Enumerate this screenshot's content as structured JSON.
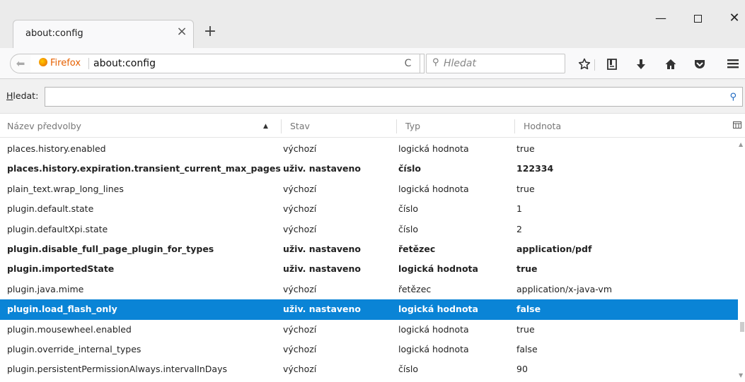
{
  "window": {
    "min_glyph": "—",
    "close_glyph": "✕"
  },
  "tab": {
    "title": "about:config",
    "close_glyph": "×",
    "newtab_glyph": "+"
  },
  "navbar": {
    "back_glyph": "⬅",
    "identity_label": "Firefox",
    "url": "about:config",
    "reload_glyph": "C",
    "search_placeholder": "Hledat",
    "search_glyph": "⚲",
    "icons": [
      "star-icon",
      "reading-list-icon",
      "download-icon",
      "home-icon",
      "pocket-icon",
      "menu-icon"
    ]
  },
  "filter": {
    "label_first": "H",
    "label_rest": "ledat:",
    "value": "",
    "search_glyph": "⚲"
  },
  "columns": {
    "name": "Název předvolby",
    "status": "Stav",
    "type": "Typ",
    "value": "Hodnota"
  },
  "rows": [
    {
      "name": "places.history.enabled",
      "status": "výchozí",
      "type": "logická hodnota",
      "value": "true",
      "modified": false,
      "selected": false
    },
    {
      "name": "places.history.expiration.transient_current_max_pages",
      "status": "uživ. nastaveno",
      "type": "číslo",
      "value": "122334",
      "modified": true,
      "selected": false
    },
    {
      "name": "plain_text.wrap_long_lines",
      "status": "výchozí",
      "type": "logická hodnota",
      "value": "true",
      "modified": false,
      "selected": false
    },
    {
      "name": "plugin.default.state",
      "status": "výchozí",
      "type": "číslo",
      "value": "1",
      "modified": false,
      "selected": false
    },
    {
      "name": "plugin.defaultXpi.state",
      "status": "výchozí",
      "type": "číslo",
      "value": "2",
      "modified": false,
      "selected": false
    },
    {
      "name": "plugin.disable_full_page_plugin_for_types",
      "status": "uživ. nastaveno",
      "type": "řetězec",
      "value": "application/pdf",
      "modified": true,
      "selected": false
    },
    {
      "name": "plugin.importedState",
      "status": "uživ. nastaveno",
      "type": "logická hodnota",
      "value": "true",
      "modified": true,
      "selected": false
    },
    {
      "name": "plugin.java.mime",
      "status": "výchozí",
      "type": "řetězec",
      "value": "application/x-java-vm",
      "modified": false,
      "selected": false
    },
    {
      "name": "plugin.load_flash_only",
      "status": "uživ. nastaveno",
      "type": "logická hodnota",
      "value": "false",
      "modified": true,
      "selected": true
    },
    {
      "name": "plugin.mousewheel.enabled",
      "status": "výchozí",
      "type": "logická hodnota",
      "value": "true",
      "modified": false,
      "selected": false
    },
    {
      "name": "plugin.override_internal_types",
      "status": "výchozí",
      "type": "logická hodnota",
      "value": "false",
      "modified": false,
      "selected": false
    },
    {
      "name": "plugin.persistentPermissionAlways.intervalInDays",
      "status": "výchozí",
      "type": "číslo",
      "value": "90",
      "modified": false,
      "selected": false
    }
  ],
  "colors": {
    "selection": "#0a84d6",
    "titlebar": "#ebebeb",
    "toolbar": "#f9f9fa"
  }
}
